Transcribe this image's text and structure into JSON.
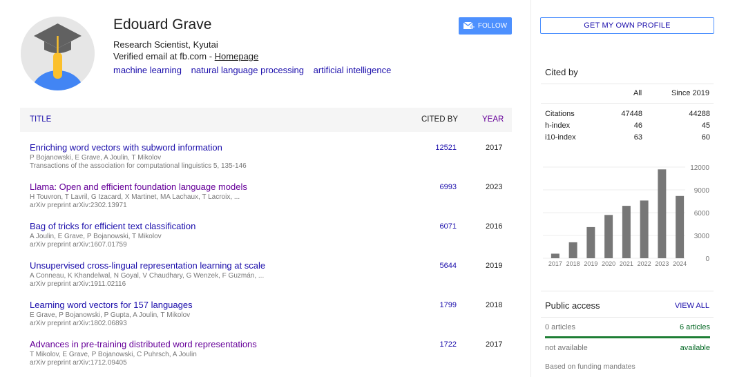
{
  "profile": {
    "name": "Edouard Grave",
    "affiliation": "Research Scientist, Kyutai",
    "verified": "Verified email at fb.com - ",
    "homepage_label": "Homepage",
    "interests": [
      "machine learning",
      "natural language processing",
      "artificial intelligence"
    ],
    "avatar_icon": "graduation-cap-person-icon",
    "follow_label": "FOLLOW"
  },
  "colors": {
    "link": "#1a0dab",
    "visited": "#660099",
    "accent": "#4d90fe",
    "bar": "#777777",
    "public_access": "#1e7e34"
  },
  "table": {
    "headers": {
      "title": "TITLE",
      "cited_by": "CITED BY",
      "year": "YEAR"
    },
    "rows": [
      {
        "title": "Enriching word vectors with subword information",
        "authors": "P Bojanowski, E Grave, A Joulin, T Mikolov",
        "venue": "Transactions of the association for computational linguistics 5, 135-146",
        "cited_by": "12521",
        "year": "2017",
        "visited": false
      },
      {
        "title": "Llama: Open and efficient foundation language models",
        "authors": "H Touvron, T Lavril, G Izacard, X Martinet, MA Lachaux, T Lacroix, ...",
        "venue": "arXiv preprint arXiv:2302.13971",
        "cited_by": "6993",
        "year": "2023",
        "visited": true
      },
      {
        "title": "Bag of tricks for efficient text classification",
        "authors": "A Joulin, E Grave, P Bojanowski, T Mikolov",
        "venue": "arXiv preprint arXiv:1607.01759",
        "cited_by": "6071",
        "year": "2016",
        "visited": false
      },
      {
        "title": "Unsupervised cross-lingual representation learning at scale",
        "authors": "A Conneau, K Khandelwal, N Goyal, V Chaudhary, G Wenzek, F Guzmán, ...",
        "venue": "arXiv preprint arXiv:1911.02116",
        "cited_by": "5644",
        "year": "2019",
        "visited": false
      },
      {
        "title": "Learning word vectors for 157 languages",
        "authors": "E Grave, P Bojanowski, P Gupta, A Joulin, T Mikolov",
        "venue": "arXiv preprint arXiv:1802.06893",
        "cited_by": "1799",
        "year": "2018",
        "visited": false
      },
      {
        "title": "Advances in pre-training distributed word representations",
        "authors": "T Mikolov, E Grave, P Bojanowski, C Puhrsch, A Joulin",
        "venue": "arXiv preprint arXiv:1712.09405",
        "cited_by": "1722",
        "year": "2017",
        "visited": true
      }
    ]
  },
  "sidebar": {
    "own_profile_label": "GET MY OWN PROFILE",
    "cited_by_title": "Cited by",
    "stats_headers": {
      "all": "All",
      "since": "Since 2019"
    },
    "stats": [
      {
        "label": "Citations",
        "all": "47448",
        "since": "44288"
      },
      {
        "label": "h-index",
        "all": "46",
        "since": "45"
      },
      {
        "label": "i10-index",
        "all": "63",
        "since": "60"
      }
    ],
    "public_access": {
      "title": "Public access",
      "view_all": "VIEW ALL",
      "not_available_count": "0 articles",
      "available_count": "6 articles",
      "not_available_label": "not available",
      "available_label": "available",
      "available_fraction": 1.0,
      "note": "Based on funding mandates"
    }
  },
  "chart_data": {
    "type": "bar",
    "categories": [
      "2017",
      "2018",
      "2019",
      "2020",
      "2021",
      "2022",
      "2023",
      "2024"
    ],
    "values": [
      600,
      2100,
      4100,
      5700,
      6900,
      7600,
      11700,
      8200
    ],
    "yticks": [
      0,
      3000,
      6000,
      9000,
      12000
    ],
    "ylim": [
      0,
      12000
    ],
    "title": "",
    "xlabel": "",
    "ylabel": ""
  }
}
